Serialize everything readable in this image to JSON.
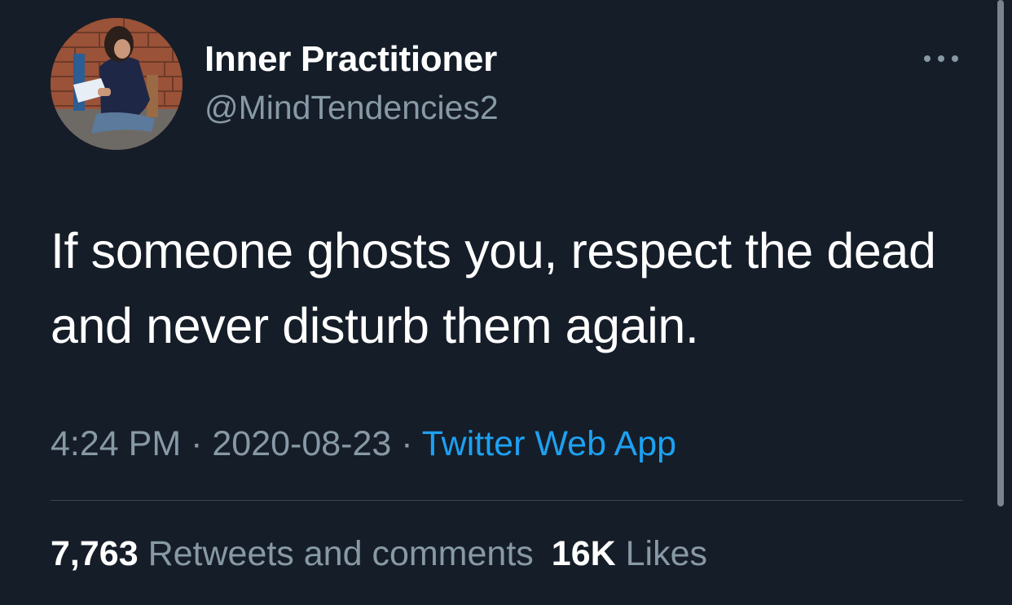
{
  "user": {
    "display_name": "Inner Practitioner",
    "handle": "@MindTendencies2",
    "avatar_icon": "user-photo-avatar"
  },
  "menu": {
    "icon": "more-horizontal-icon"
  },
  "tweet": {
    "text": "If someone ghosts you, respect the dead and never disturb them again."
  },
  "meta": {
    "time": "4:24 PM",
    "separator": " · ",
    "date": "2020-08-23",
    "source": "Twitter Web App"
  },
  "stats": {
    "retweets_count": "7,763",
    "retweets_label": "Retweets and comments",
    "likes_count": "16K",
    "likes_label": "Likes"
  },
  "colors": {
    "background": "#151d28",
    "primary_text": "#ffffff",
    "secondary_text": "#8899a6",
    "link": "#1da1f2",
    "divider": "#38444d"
  }
}
